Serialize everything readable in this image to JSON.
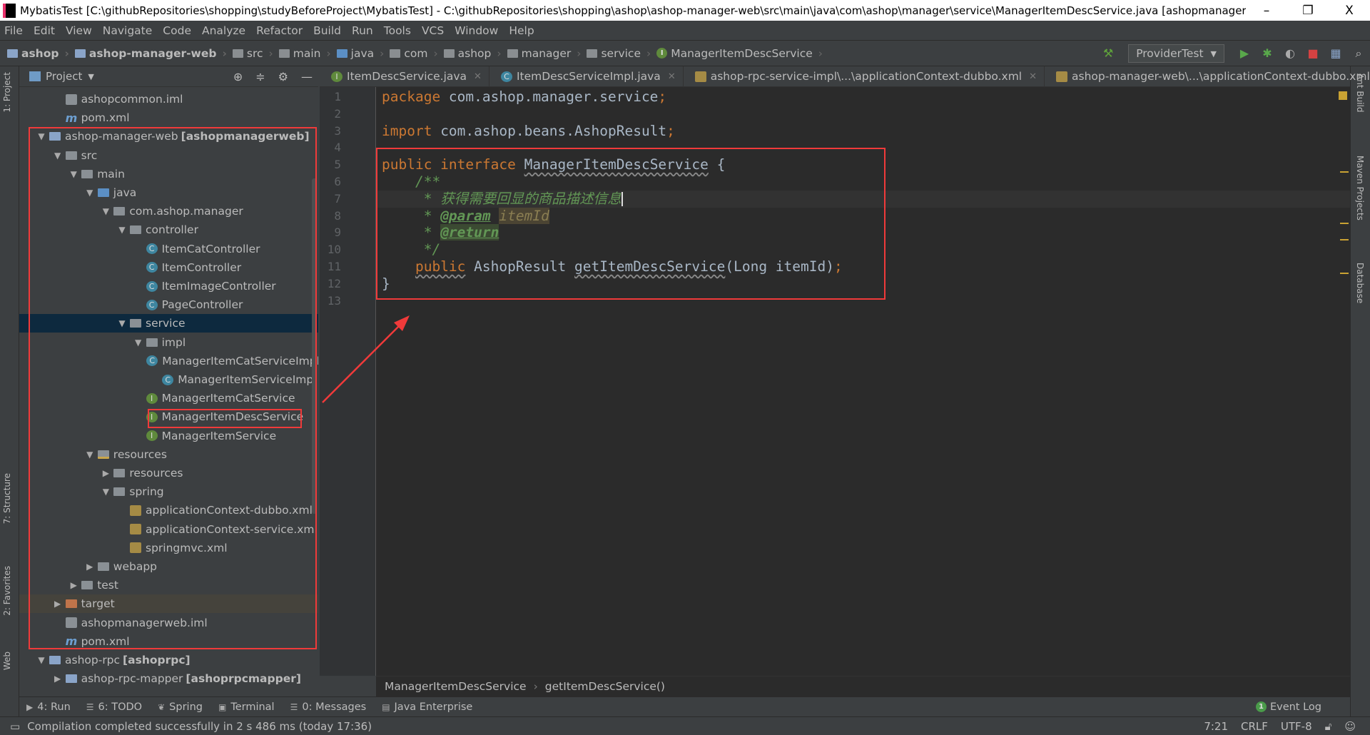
{
  "window": {
    "title": "MybatisTest [C:\\githubRepositories\\shopping\\studyBeforeProject\\MybatisTest] - C:\\githubRepositories\\shopping\\ashop\\ashop-manager-web\\src\\main\\java\\com\\ashop\\manager\\service\\ManagerItemDescService.java [ashopmanager...",
    "minimize": "–",
    "restore": "❐",
    "close": "X"
  },
  "menu": [
    "File",
    "Edit",
    "View",
    "Navigate",
    "Code",
    "Analyze",
    "Refactor",
    "Build",
    "Run",
    "Tools",
    "VCS",
    "Window",
    "Help"
  ],
  "breadcrumbs": [
    {
      "label": "ashop",
      "icon": "module-folder-icon",
      "bold": true
    },
    {
      "label": "ashop-manager-web",
      "icon": "module-folder-icon",
      "bold": true
    },
    {
      "label": "src",
      "icon": "folder-icon"
    },
    {
      "label": "main",
      "icon": "folder-icon"
    },
    {
      "label": "java",
      "icon": "source-folder-icon"
    },
    {
      "label": "com",
      "icon": "folder-icon"
    },
    {
      "label": "ashop",
      "icon": "folder-icon"
    },
    {
      "label": "manager",
      "icon": "folder-icon"
    },
    {
      "label": "service",
      "icon": "folder-icon"
    },
    {
      "label": "ManagerItemDescService",
      "icon": "interface-icon"
    }
  ],
  "toolbar": {
    "run_config": "ProviderTest",
    "build": "hammer-icon",
    "run": "run-icon",
    "debug": "debug-icon",
    "coverage": "coverage-icon",
    "stop": "stop-icon",
    "structure": "project-structure-icon",
    "search": "search-icon"
  },
  "left_strip": {
    "project": "1: Project",
    "structure": "7: Structure",
    "favorites": "2: Favorites",
    "web": "Web"
  },
  "right_strip": {
    "ant": "Ant Build",
    "maven": "Maven Projects",
    "database": "Database"
  },
  "project_panel": {
    "title": "Project",
    "tree": [
      {
        "label": "ashopcommon.iml",
        "level": 1,
        "type": "iml"
      },
      {
        "label": "pom.xml",
        "level": 1,
        "type": "pom"
      },
      {
        "label": "ashop-manager-web",
        "suffix": "[ashopmanagerweb]",
        "level": 0,
        "type": "mod",
        "expanded": true
      },
      {
        "label": "src",
        "level": 1,
        "type": "folder",
        "expanded": true
      },
      {
        "label": "main",
        "level": 2,
        "type": "folder",
        "expanded": true
      },
      {
        "label": "java",
        "level": 3,
        "type": "src",
        "expanded": true
      },
      {
        "label": "com.ashop.manager",
        "level": 4,
        "type": "folder",
        "expanded": true
      },
      {
        "label": "controller",
        "level": 5,
        "type": "folder",
        "expanded": true
      },
      {
        "label": "ItemCatController",
        "level": 6,
        "type": "cls"
      },
      {
        "label": "ItemController",
        "level": 6,
        "type": "cls"
      },
      {
        "label": "ItemImageController",
        "level": 6,
        "type": "cls"
      },
      {
        "label": "PageController",
        "level": 6,
        "type": "cls"
      },
      {
        "label": "service",
        "level": 5,
        "type": "folder",
        "expanded": true,
        "selected": true
      },
      {
        "label": "impl",
        "level": 6,
        "type": "folder",
        "expanded": true
      },
      {
        "label": "ManagerItemCatServiceImpl",
        "level": 7,
        "type": "cls"
      },
      {
        "label": "ManagerItemServiceImpl",
        "level": 7,
        "type": "cls"
      },
      {
        "label": "ManagerItemCatService",
        "level": 6,
        "type": "intf"
      },
      {
        "label": "ManagerItemDescService",
        "level": 6,
        "type": "intf"
      },
      {
        "label": "ManagerItemService",
        "level": 6,
        "type": "intf"
      },
      {
        "label": "resources",
        "level": 3,
        "type": "res",
        "expanded": true
      },
      {
        "label": "resources",
        "level": 4,
        "type": "folder",
        "expanded": false
      },
      {
        "label": "spring",
        "level": 4,
        "type": "folder",
        "expanded": true
      },
      {
        "label": "applicationContext-dubbo.xml",
        "level": 5,
        "type": "xml"
      },
      {
        "label": "applicationContext-service.xml",
        "level": 5,
        "type": "xml"
      },
      {
        "label": "springmvc.xml",
        "level": 5,
        "type": "xml"
      },
      {
        "label": "webapp",
        "level": 3,
        "type": "folder",
        "expanded": false
      },
      {
        "label": "test",
        "level": 2,
        "type": "folder",
        "expanded": false
      },
      {
        "label": "target",
        "level": 1,
        "type": "target",
        "expanded": false,
        "dim": true
      },
      {
        "label": "ashopmanagerweb.iml",
        "level": 1,
        "type": "iml"
      },
      {
        "label": "pom.xml",
        "level": 1,
        "type": "pom"
      },
      {
        "label": "ashop-rpc",
        "suffix": "[ashoprpc]",
        "level": 0,
        "type": "mod",
        "expanded": true
      },
      {
        "label": "ashop-rpc-mapper",
        "suffix": "[ashoprpcmapper]",
        "level": 1,
        "type": "mod",
        "expanded": false
      }
    ]
  },
  "tabs": [
    {
      "label": "ItemDescService.java",
      "type": "intf"
    },
    {
      "label": "ItemDescServiceImpl.java",
      "type": "cls"
    },
    {
      "label": "ashop-rpc-service-impl\\...\\applicationContext-dubbo.xml",
      "type": "xml"
    },
    {
      "label": "ashop-manager-web\\...\\applicationContext-dubbo.xml",
      "type": "xml"
    }
  ],
  "editor": {
    "current_line": 7,
    "lines": [
      [
        {
          "t": "package ",
          "k": "keyword"
        },
        {
          "t": "com.ashop.manager.service",
          "k": "text"
        },
        {
          "t": ";",
          "k": "punct"
        }
      ],
      [],
      [
        {
          "t": "import ",
          "k": "keyword"
        },
        {
          "t": "com.ashop.beans.AshopResult",
          "k": "text"
        },
        {
          "t": ";",
          "k": "punct"
        }
      ],
      [],
      [
        {
          "t": "public interface ",
          "k": "keyword"
        },
        {
          "t": "ManagerItemDescService",
          "k": "warn"
        },
        {
          "t": " {",
          "k": "text"
        }
      ],
      [
        {
          "t": "    /**",
          "k": "comment"
        }
      ],
      [
        {
          "t": "     * 获得需要回显的商品描述信息",
          "k": "comment"
        }
      ],
      [
        {
          "t": "     * ",
          "k": "comment"
        },
        {
          "t": "@param",
          "k": "tag"
        },
        {
          "t": " ",
          "k": "comment"
        },
        {
          "t": "itemId",
          "k": "param"
        }
      ],
      [
        {
          "t": "     * ",
          "k": "comment"
        },
        {
          "t": "@return",
          "k": "tagret"
        }
      ],
      [
        {
          "t": "     */",
          "k": "comment"
        }
      ],
      [
        {
          "t": "    ",
          "k": "text"
        },
        {
          "t": "public",
          "k": "kwwarn"
        },
        {
          "t": " AshopResult ",
          "k": "text"
        },
        {
          "t": "getItemDescService",
          "k": "warn"
        },
        {
          "t": "(Long itemId)",
          "k": "text"
        },
        {
          "t": ";",
          "k": "punct"
        }
      ],
      [
        {
          "t": "}",
          "k": "text"
        }
      ],
      []
    ]
  },
  "editor_breadcrumb": [
    "ManagerItemDescService",
    "getItemDescService()"
  ],
  "tool_windows": [
    {
      "label": "4: Run",
      "icon": "run-icon"
    },
    {
      "label": "6: TODO",
      "icon": "todo-icon"
    },
    {
      "label": "Spring",
      "icon": "spring-icon"
    },
    {
      "label": "Terminal",
      "icon": "terminal-icon"
    },
    {
      "label": "0: Messages",
      "icon": "messages-icon"
    },
    {
      "label": "Java Enterprise",
      "icon": "java-enterprise-icon"
    }
  ],
  "event_log": {
    "label": "Event Log",
    "count": "1"
  },
  "status": {
    "message": "Compilation completed successfully in 2 s 486 ms (today 17:36)",
    "position": "7:21",
    "line_sep": "CRLF",
    "encoding": "UTF-8"
  },
  "annotation_color": "#f03a3a"
}
